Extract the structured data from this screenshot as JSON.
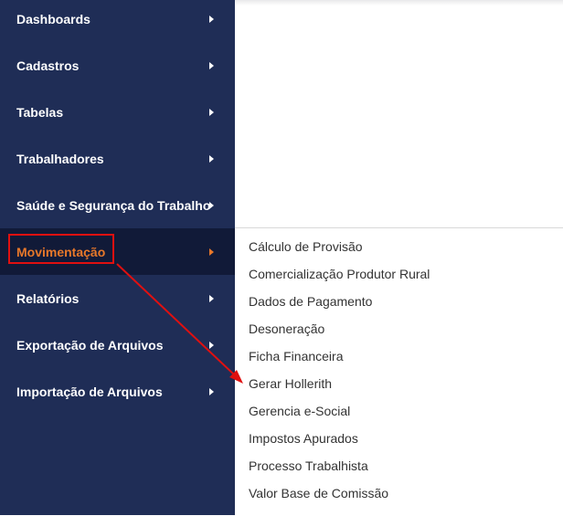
{
  "sidebar": {
    "items": [
      {
        "label": "Dashboards"
      },
      {
        "label": "Cadastros"
      },
      {
        "label": "Tabelas"
      },
      {
        "label": "Trabalhadores"
      },
      {
        "label": "Saúde e Segurança do Trabalho"
      },
      {
        "label": "Movimentação",
        "active": true
      },
      {
        "label": "Relatórios"
      },
      {
        "label": "Exportação de Arquivos"
      },
      {
        "label": "Importação de Arquivos"
      }
    ]
  },
  "submenu": {
    "items": [
      {
        "label": "Cálculo de Provisão"
      },
      {
        "label": "Comercialização Produtor Rural"
      },
      {
        "label": "Dados de Pagamento"
      },
      {
        "label": "Desoneração"
      },
      {
        "label": "Ficha Financeira"
      },
      {
        "label": "Gerar Hollerith"
      },
      {
        "label": "Gerencia e-Social"
      },
      {
        "label": "Impostos Apurados"
      },
      {
        "label": "Processo Trabalhista"
      },
      {
        "label": "Valor Base de Comissão"
      }
    ]
  },
  "colors": {
    "sidebar_bg": "#1f2d56",
    "active_bg": "#111a38",
    "active_text": "#e8782a",
    "annotation": "#e01010"
  },
  "icons": {
    "nav_chevron": "chevron-right-icon",
    "annotation_arrow": "annotation-arrow-icon"
  }
}
